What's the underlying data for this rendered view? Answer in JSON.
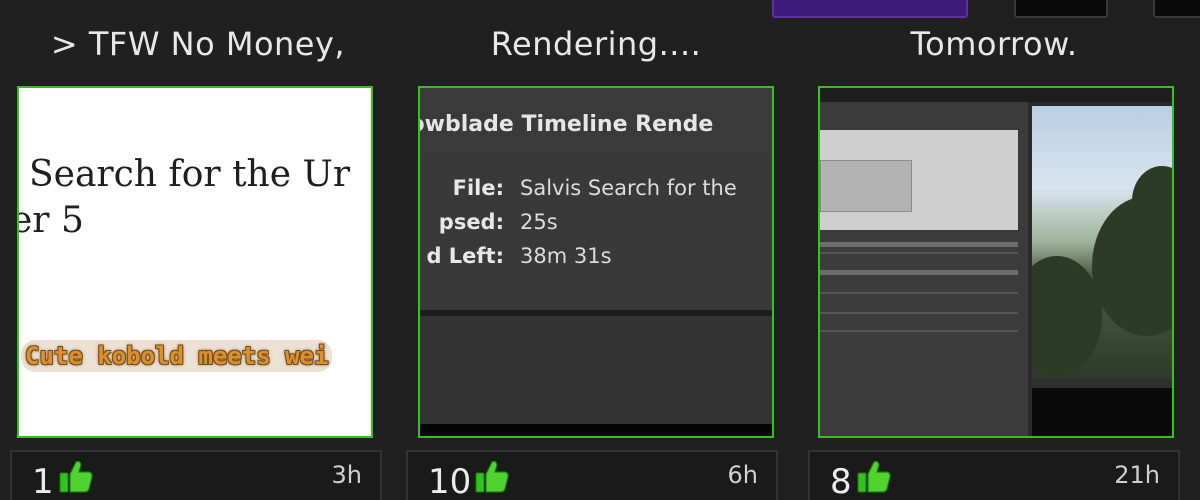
{
  "top_bar": {
    "buttons": [
      {
        "name": "purple-action-button",
        "color": "#3e1b7a"
      },
      {
        "name": "dark-button-1",
        "color": "#0a0a0a"
      },
      {
        "name": "dark-button-2",
        "color": "#0a0a0a"
      }
    ]
  },
  "accent_color": "#35c21b",
  "cards": [
    {
      "title": "> TFW No Money,",
      "thumbnail": {
        "doc_line_1": "Search for the Ur",
        "doc_line_2": "er 5",
        "caption": "Cute kobold meets wei"
      },
      "likes": "1",
      "like_icon": "thumbs-up-icon",
      "age": "3h"
    },
    {
      "title": "Rendering....",
      "thumbnail": {
        "dialog_title": "lowblade Timeline Rende",
        "rows": [
          {
            "label": "File:",
            "value": "Salvis Search for the"
          },
          {
            "label": "psed:",
            "value": "25s"
          },
          {
            "label": "d Left:",
            "value": "38m 31s"
          }
        ]
      },
      "likes": "10",
      "like_icon": "thumbs-up-icon",
      "age": "6h"
    },
    {
      "title": "Tomorrow.",
      "thumbnail": {
        "description_icon": "video-editor-screenshot"
      },
      "likes": "8",
      "like_icon": "thumbs-up-icon",
      "age": "21h"
    }
  ]
}
